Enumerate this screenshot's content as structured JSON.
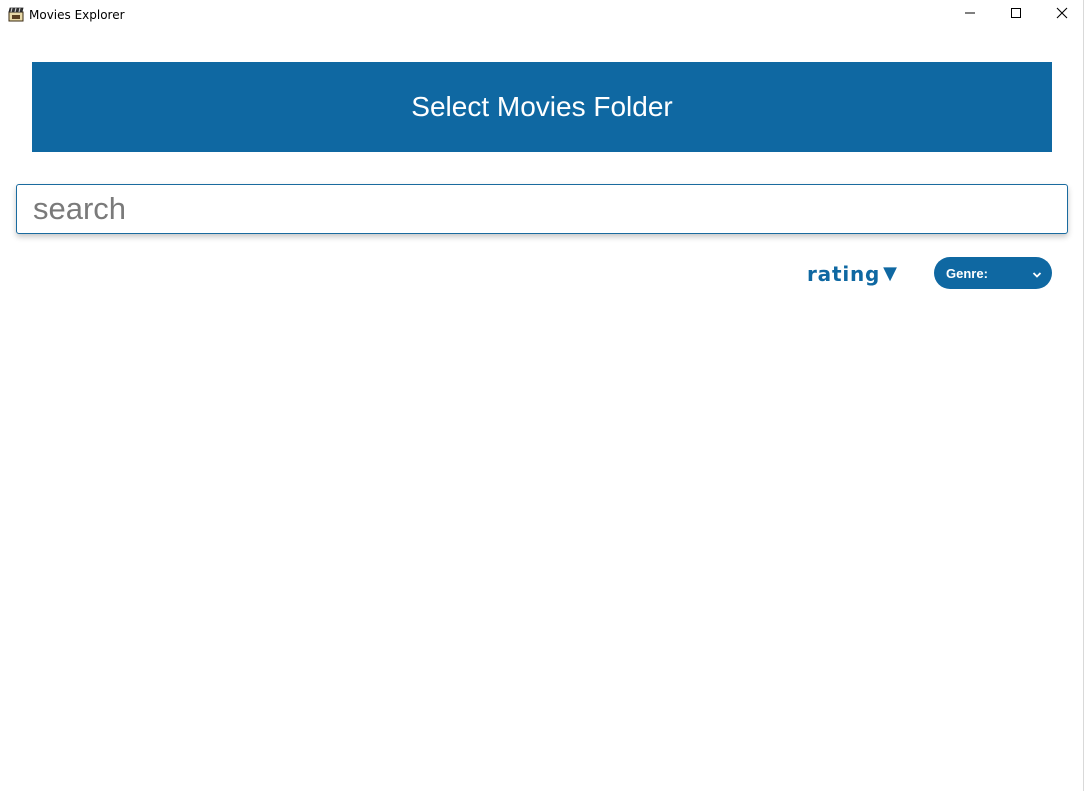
{
  "window": {
    "title": "Movies Explorer",
    "app_icon": "clapperboard-icon",
    "controls": {
      "minimize": "minimize-icon",
      "maximize": "maximize-icon",
      "close": "close-icon"
    }
  },
  "main": {
    "select_folder_label": "Select Movies Folder",
    "search": {
      "placeholder": "search",
      "value": ""
    },
    "sort": {
      "label": "rating",
      "direction_symbol": "▼"
    },
    "genre": {
      "label": "Genre:",
      "icon": "chevron-down-icon"
    }
  },
  "colors": {
    "accent": "#0f68a2",
    "button_text": "#ffffff",
    "background": "#ffffff"
  }
}
